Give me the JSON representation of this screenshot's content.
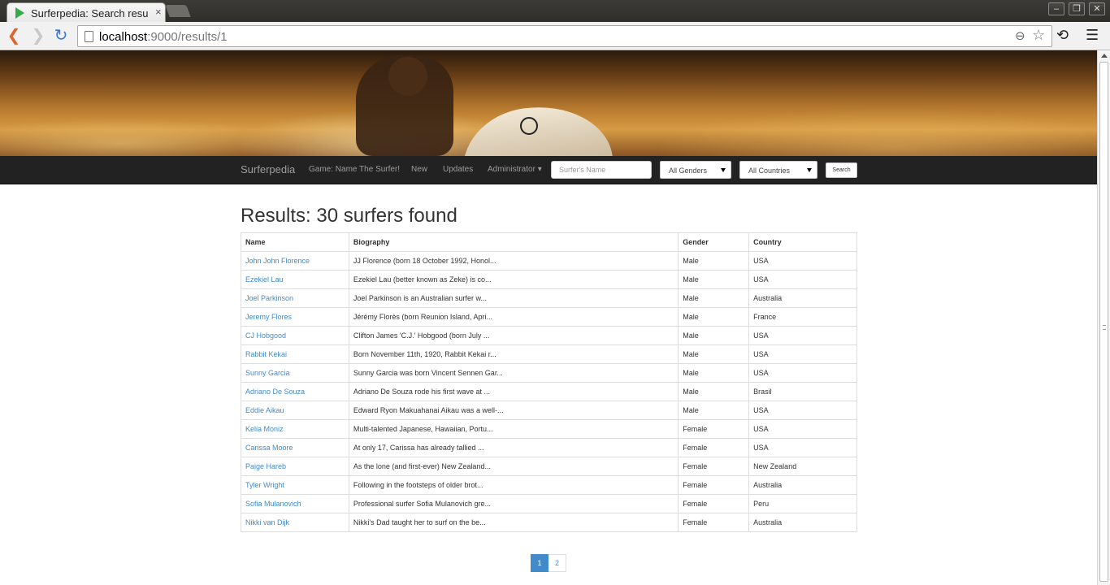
{
  "browser": {
    "tab_title": "Surferpedia: Search results",
    "tab_close": "×",
    "url_host": "localhost",
    "url_rest": ":9000/results/1",
    "window_buttons": [
      "–",
      "❐",
      "✕"
    ]
  },
  "navbar": {
    "brand": "Surferpedia",
    "links": [
      "Game: Name The Surfer!",
      "New",
      "Updates",
      "Administrator"
    ],
    "search_placeholder": "Surfer's Name",
    "gender_select": "All Genders",
    "country_select": "All Countries",
    "search_button": "Search"
  },
  "results": {
    "title": "Results: 30 surfers found",
    "columns": [
      "Name",
      "Biography",
      "Gender",
      "Country"
    ],
    "rows": [
      {
        "name": "John John Florence",
        "bio": "JJ Florence (born 18 October 1992, Honol...",
        "gender": "Male",
        "country": "USA"
      },
      {
        "name": "Ezekiel Lau",
        "bio": "Ezekiel Lau (better known as Zeke) is co...",
        "gender": "Male",
        "country": "USA"
      },
      {
        "name": "Joel Parkinson",
        "bio": "Joel Parkinson is an Australian surfer w...",
        "gender": "Male",
        "country": "Australia"
      },
      {
        "name": "Jeremy Flores",
        "bio": "Jérémy Florès (born Reunion Island, Apri...",
        "gender": "Male",
        "country": "France"
      },
      {
        "name": "CJ Hobgood",
        "bio": "Clifton James 'C.J.' Hobgood (born July ...",
        "gender": "Male",
        "country": "USA"
      },
      {
        "name": "Rabbit Kekai",
        "bio": "Born November 11th, 1920, Rabbit Kekai r...",
        "gender": "Male",
        "country": "USA"
      },
      {
        "name": "Sunny Garcia",
        "bio": "Sunny Garcia was born Vincent Sennen Gar...",
        "gender": "Male",
        "country": "USA"
      },
      {
        "name": "Adriano De Souza",
        "bio": "Adriano De Souza rode his first wave at ...",
        "gender": "Male",
        "country": "Brasil"
      },
      {
        "name": "Eddie Aikau",
        "bio": "Edward Ryon Makuahanai Aikau was a well-...",
        "gender": "Male",
        "country": "USA"
      },
      {
        "name": "Kelia Moniz",
        "bio": "Multi-talented Japanese, Hawaiian, Portu...",
        "gender": "Female",
        "country": "USA"
      },
      {
        "name": "Carissa Moore",
        "bio": "At only 17, Carissa has already tallied ...",
        "gender": "Female",
        "country": "USA"
      },
      {
        "name": "Paige Hareb",
        "bio": "As the lone (and first-ever) New Zealand...",
        "gender": "Female",
        "country": "New Zealand"
      },
      {
        "name": "Tyler Wright",
        "bio": "Following in the footsteps of older brot...",
        "gender": "Female",
        "country": "Australia"
      },
      {
        "name": "Sofia Mulanovich",
        "bio": "Professional surfer Sofia Mulanovich gre...",
        "gender": "Female",
        "country": "Peru"
      },
      {
        "name": "Nikki van Dijk",
        "bio": "Nikki's Dad taught her to surf on the be...",
        "gender": "Female",
        "country": "Australia"
      }
    ]
  },
  "pagination": {
    "pages": [
      "1",
      "2"
    ],
    "active": "1"
  },
  "colors": {
    "link": "#428bca",
    "navbar_bg": "#222222",
    "active_page": "#428bca"
  }
}
